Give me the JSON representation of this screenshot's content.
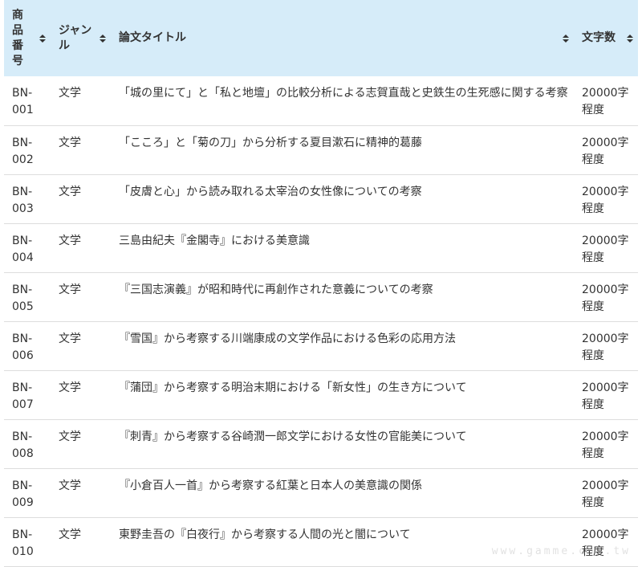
{
  "table": {
    "headers": {
      "id": "商品番号",
      "genre": "ジャンル",
      "title": "論文タイトル",
      "count": "文字数"
    },
    "rows": [
      {
        "id": "BN-001",
        "genre": "文学",
        "title": "「城の里にて」と「私と地壇」の比較分析による志賀直哉と史鉄生の生死感に関する考察",
        "count": "20000字程度"
      },
      {
        "id": "BN-002",
        "genre": "文学",
        "title": "「こころ」と「菊の刀」から分析する夏目漱石に精神的葛藤",
        "count": "20000字程度"
      },
      {
        "id": "BN-003",
        "genre": "文学",
        "title": "「皮膚と心」から読み取れる太宰治の女性像についての考察",
        "count": "20000字程度"
      },
      {
        "id": "BN-004",
        "genre": "文学",
        "title": "三島由紀夫『金閣寺』における美意識",
        "count": "20000字程度"
      },
      {
        "id": "BN-005",
        "genre": "文学",
        "title": "『三国志演義』が昭和時代に再創作された意義についての考察",
        "count": "20000字程度"
      },
      {
        "id": "BN-006",
        "genre": "文学",
        "title": "『雪国』から考察する川端康成の文学作品における色彩の応用方法",
        "count": "20000字程度"
      },
      {
        "id": "BN-007",
        "genre": "文学",
        "title": "『蒲団』から考察する明治末期における「新女性」の生き方について",
        "count": "20000字程度"
      },
      {
        "id": "BN-008",
        "genre": "文学",
        "title": "『刺青』から考察する谷崎潤一郎文学における女性の官能美について",
        "count": "20000字程度"
      },
      {
        "id": "BN-009",
        "genre": "文学",
        "title": "『小倉百人一首』から考察する紅葉と日本人の美意識の関係",
        "count": "20000字程度"
      },
      {
        "id": "BN-010",
        "genre": "文学",
        "title": "東野圭吾の『白夜行』から考察する人間の光と闇について",
        "count": "20000字程度"
      }
    ]
  },
  "watermark": "www.gamme.com.tw",
  "colors": {
    "header_bg": "#d6ecf9",
    "text": "#333333",
    "row_border": "#dddddd"
  },
  "icons": {
    "sort": "sort-icon"
  }
}
